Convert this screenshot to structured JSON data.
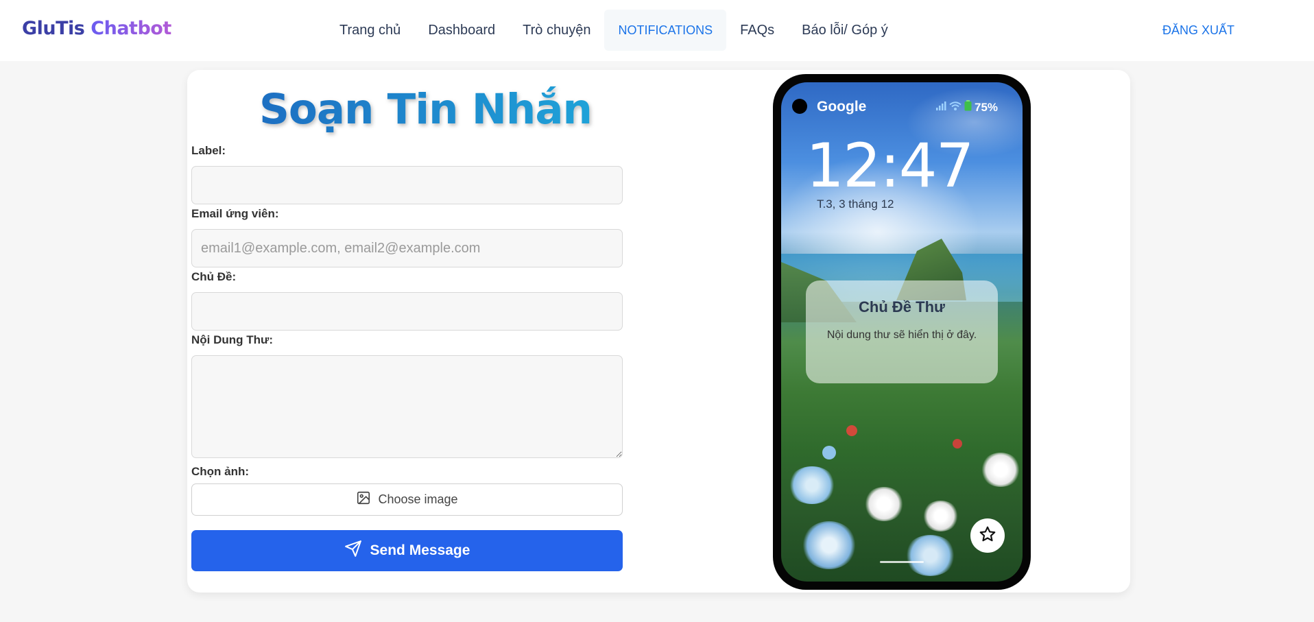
{
  "brand": {
    "part1": "GluTis",
    "part2": "Chatbot"
  },
  "nav": {
    "items": [
      {
        "label": "Trang chủ"
      },
      {
        "label": "Dashboard"
      },
      {
        "label": "Trò chuyện"
      },
      {
        "label": "NOTIFICATIONS",
        "active": true
      },
      {
        "label": "FAQs"
      },
      {
        "label": "Báo lỗi/ Góp ý"
      }
    ],
    "logout": "ĐĂNG XUẤT"
  },
  "form": {
    "title": "Soạn Tin Nhắn",
    "label_label": "Label:",
    "label_value": "",
    "email_label": "Email ứng viên:",
    "email_placeholder": "email1@example.com, email2@example.com",
    "subject_label": "Chủ Đề:",
    "subject_value": "",
    "body_label": "Nội Dung Thư:",
    "body_value": "",
    "image_label": "Chọn ảnh:",
    "choose_image": "Choose image",
    "send": "Send Message"
  },
  "phone": {
    "carrier": "Google",
    "battery": "75%",
    "time": "12:47",
    "date": "T.3, 3 tháng 12",
    "notification": {
      "title": "Chủ Đề Thư",
      "body": "Nội dung thư sẽ hiển thị ở đây."
    }
  },
  "colors": {
    "accent": "#1a73e8",
    "send_button": "#2563eb",
    "title_gradient": [
      "#1d6fc2",
      "#1fa2d8"
    ]
  },
  "icons": [
    "image-icon",
    "send-icon",
    "signal-icon",
    "wifi-icon",
    "battery-icon",
    "star-icon"
  ]
}
